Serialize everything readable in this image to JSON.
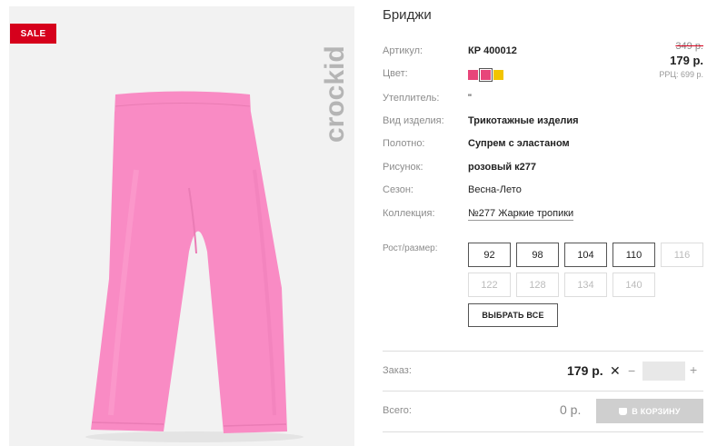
{
  "badge": "SALE",
  "brand": "crockid",
  "product": {
    "title": "Бриджи",
    "specs": {
      "article_label": "Артикул:",
      "article_value": "КР 400012",
      "color_label": "Цвет:",
      "insulation_label": "Утеплитель:",
      "insulation_value": "\"",
      "type_label": "Вид изделия:",
      "type_value": "Трикотажные изделия",
      "fabric_label": "Полотно:",
      "fabric_value": "Супрем с эластаном",
      "pattern_label": "Рисунок:",
      "pattern_value": "розовый к277",
      "season_label": "Сезон:",
      "season_value": "Весна-Лето",
      "collection_label": "Коллекция:",
      "collection_value": "№277 Жаркие тропики"
    },
    "colors": [
      "#e8457a",
      "#e8457a",
      "#f2c400"
    ]
  },
  "price": {
    "old": "349 р.",
    "new": "179 р.",
    "rrc": "РРЦ: 699 р."
  },
  "sizes": {
    "label": "Рост/размер:",
    "items": [
      {
        "label": "92",
        "available": true
      },
      {
        "label": "98",
        "available": true
      },
      {
        "label": "104",
        "available": true
      },
      {
        "label": "110",
        "available": true
      },
      {
        "label": "116",
        "available": false
      },
      {
        "label": "122",
        "available": false
      },
      {
        "label": "128",
        "available": false
      },
      {
        "label": "134",
        "available": false
      },
      {
        "label": "140",
        "available": false
      }
    ],
    "select_all": "ВЫБРАТЬ ВСЕ"
  },
  "order": {
    "label": "Заказ:",
    "price": "179 р.",
    "times": "✕",
    "minus": "−",
    "plus": "+",
    "qty": ""
  },
  "total": {
    "label": "Всего:",
    "value": "0 р.",
    "cart_button": "В КОРЗИНУ"
  },
  "theme": {
    "sale_red": "#d6001c",
    "product_pink": "#f98bc4",
    "image_bg": "#f2f2f2"
  }
}
